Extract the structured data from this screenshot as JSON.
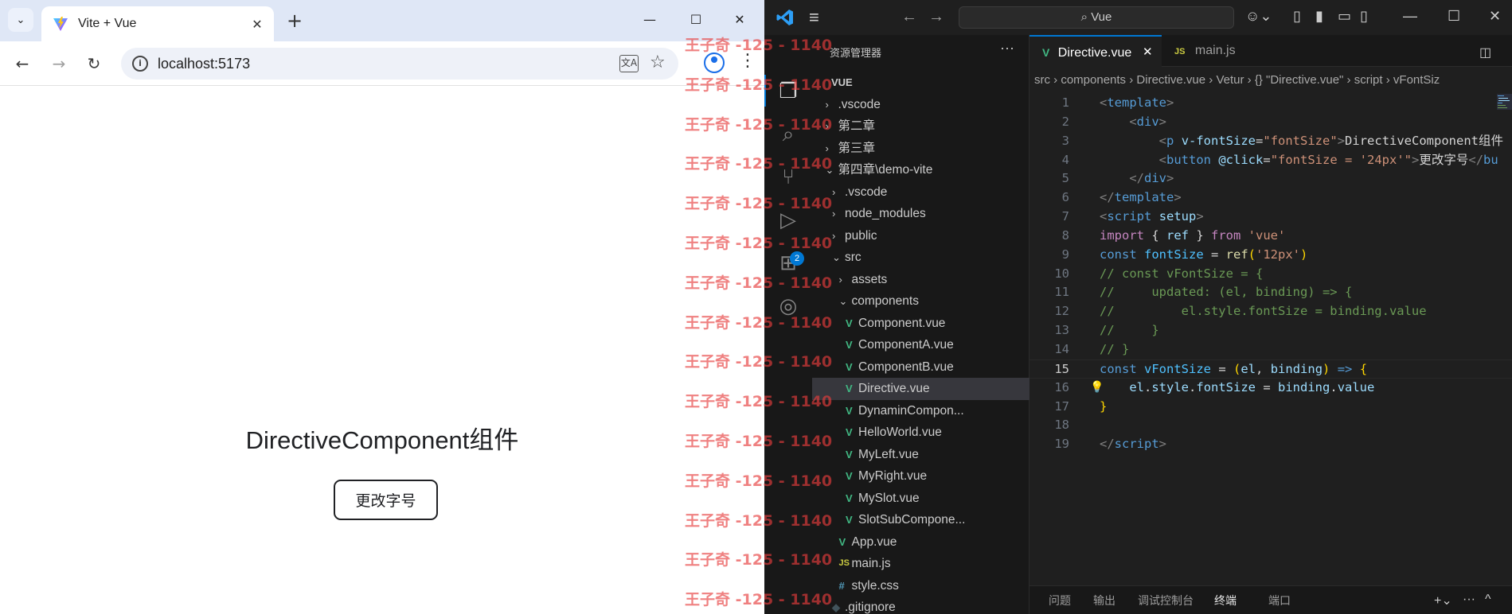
{
  "browser": {
    "tab": {
      "title": "Vite + Vue",
      "close": "✕"
    },
    "new_tab": "+",
    "window": {
      "min": "—",
      "max": "☐",
      "close": "✕"
    },
    "nav": {
      "back": "←",
      "forward": "→",
      "reload": "↻"
    },
    "address": {
      "url": "localhost:5173"
    },
    "page": {
      "heading": "DirectiveComponent组件",
      "button": "更改字号"
    }
  },
  "vscode": {
    "titlebar": {
      "search": "⌕ Vue"
    },
    "activity_badge": "2",
    "sidebar": {
      "title": "资源管理器",
      "more": "···",
      "tree": [
        {
          "label": "VUE",
          "chevron": "",
          "icon": "",
          "indent": 0,
          "bold": true
        },
        {
          "label": ".vscode",
          "chevron": "›",
          "icon": "",
          "indent": 1
        },
        {
          "label": "第二章",
          "chevron": "›",
          "icon": "",
          "indent": 1
        },
        {
          "label": "第三章",
          "chevron": "›",
          "icon": "",
          "indent": 1
        },
        {
          "label": "第四章\\demo-vite",
          "chevron": "⌄",
          "icon": "",
          "indent": 1
        },
        {
          "label": ".vscode",
          "chevron": "›",
          "icon": "",
          "indent": 2
        },
        {
          "label": "node_modules",
          "chevron": "›",
          "icon": "",
          "indent": 2
        },
        {
          "label": "public",
          "chevron": "›",
          "icon": "",
          "indent": 2
        },
        {
          "label": "src",
          "chevron": "⌄",
          "icon": "",
          "indent": 2
        },
        {
          "label": "assets",
          "chevron": "›",
          "icon": "",
          "indent": 3
        },
        {
          "label": "components",
          "chevron": "⌄",
          "icon": "",
          "indent": 3
        },
        {
          "label": "Component.vue",
          "chevron": "",
          "icon": "vue",
          "indent": 4
        },
        {
          "label": "ComponentA.vue",
          "chevron": "",
          "icon": "vue",
          "indent": 4
        },
        {
          "label": "ComponentB.vue",
          "chevron": "",
          "icon": "vue",
          "indent": 4
        },
        {
          "label": "Directive.vue",
          "chevron": "",
          "icon": "vue",
          "indent": 4,
          "selected": true
        },
        {
          "label": "DynaminCompon...",
          "chevron": "",
          "icon": "vue",
          "indent": 4
        },
        {
          "label": "HelloWorld.vue",
          "chevron": "",
          "icon": "vue",
          "indent": 4
        },
        {
          "label": "MyLeft.vue",
          "chevron": "",
          "icon": "vue",
          "indent": 4
        },
        {
          "label": "MyRight.vue",
          "chevron": "",
          "icon": "vue",
          "indent": 4
        },
        {
          "label": "MySlot.vue",
          "chevron": "",
          "icon": "vue",
          "indent": 4
        },
        {
          "label": "SlotSubCompone...",
          "chevron": "",
          "icon": "vue",
          "indent": 4
        },
        {
          "label": "App.vue",
          "chevron": "",
          "icon": "vue",
          "indent": 3
        },
        {
          "label": "main.js",
          "chevron": "",
          "icon": "js",
          "indent": 3
        },
        {
          "label": "style.css",
          "chevron": "",
          "icon": "css",
          "indent": 3
        },
        {
          "label": ".gitignore",
          "chevron": "",
          "icon": "git",
          "indent": 2
        }
      ]
    },
    "tabs": [
      {
        "label": "Directive.vue",
        "icon": "vue",
        "active": true,
        "close": "✕"
      },
      {
        "label": "main.js",
        "icon": "js",
        "active": false
      }
    ],
    "breadcrumb": {
      "parts": [
        "src",
        "components",
        "Directive.vue",
        "Vetur",
        "{} \"Directive.vue\"",
        "script",
        "vFontSiz"
      ]
    },
    "editor": {
      "active_line": 15,
      "lines": [
        [
          [
            "<",
            "#808080"
          ],
          [
            "template",
            "#569cd6"
          ],
          [
            ">",
            "#808080"
          ]
        ],
        [
          [
            "    ",
            "#d4d4d4"
          ],
          [
            "<",
            "#808080"
          ],
          [
            "div",
            "#569cd6"
          ],
          [
            ">",
            "#808080"
          ]
        ],
        [
          [
            "        ",
            "#d4d4d4"
          ],
          [
            "<",
            "#808080"
          ],
          [
            "p",
            "#569cd6"
          ],
          [
            " ",
            "#d4d4d4"
          ],
          [
            "v-fontSize",
            "#9cdcfe"
          ],
          [
            "=",
            "#d4d4d4"
          ],
          [
            "\"fontSize\"",
            "#ce9178"
          ],
          [
            ">",
            "#808080"
          ],
          [
            "DirectiveComponent组件",
            "#d4d4d4"
          ]
        ],
        [
          [
            "        ",
            "#d4d4d4"
          ],
          [
            "<",
            "#808080"
          ],
          [
            "button",
            "#569cd6"
          ],
          [
            " ",
            "#d4d4d4"
          ],
          [
            "@click",
            "#9cdcfe"
          ],
          [
            "=",
            "#d4d4d4"
          ],
          [
            "\"fontSize = ",
            "#ce9178"
          ],
          [
            "'24px'",
            "#ce9178"
          ],
          [
            "\"",
            "#ce9178"
          ],
          [
            ">",
            "#808080"
          ],
          [
            "更改字号",
            "#d4d4d4"
          ],
          [
            "</",
            "#808080"
          ],
          [
            "bu",
            "#569cd6"
          ]
        ],
        [
          [
            "    ",
            "#d4d4d4"
          ],
          [
            "</",
            "#808080"
          ],
          [
            "div",
            "#569cd6"
          ],
          [
            ">",
            "#808080"
          ]
        ],
        [
          [
            "</",
            "#808080"
          ],
          [
            "template",
            "#569cd6"
          ],
          [
            ">",
            "#808080"
          ]
        ],
        [
          [
            "<",
            "#808080"
          ],
          [
            "script",
            "#569cd6"
          ],
          [
            " ",
            "#d4d4d4"
          ],
          [
            "setup",
            "#9cdcfe"
          ],
          [
            ">",
            "#808080"
          ]
        ],
        [
          [
            "import",
            "#c586c0"
          ],
          [
            " { ",
            "#d4d4d4"
          ],
          [
            "ref",
            "#9cdcfe"
          ],
          [
            " } ",
            "#d4d4d4"
          ],
          [
            "from",
            "#c586c0"
          ],
          [
            " ",
            "#d4d4d4"
          ],
          [
            "'vue'",
            "#ce9178"
          ]
        ],
        [
          [
            "const",
            "#569cd6"
          ],
          [
            " ",
            "#d4d4d4"
          ],
          [
            "fontSize",
            "#4fc1ff"
          ],
          [
            " = ",
            "#d4d4d4"
          ],
          [
            "ref",
            "#dcdcaa"
          ],
          [
            "(",
            "#ffd700"
          ],
          [
            "'12px'",
            "#ce9178"
          ],
          [
            ")",
            "#ffd700"
          ]
        ],
        [
          [
            "// const vFontSize = {",
            "#6a9955"
          ]
        ],
        [
          [
            "//     updated: (el, binding) => {",
            "#6a9955"
          ]
        ],
        [
          [
            "//         el.style.fontSize = binding.value",
            "#6a9955"
          ]
        ],
        [
          [
            "//     }",
            "#6a9955"
          ]
        ],
        [
          [
            "// }",
            "#6a9955"
          ]
        ],
        [
          [
            "const",
            "#569cd6"
          ],
          [
            " ",
            "#d4d4d4"
          ],
          [
            "vFontSize",
            "#4fc1ff"
          ],
          [
            " = ",
            "#d4d4d4"
          ],
          [
            "(",
            "#ffd700"
          ],
          [
            "el",
            "#9cdcfe"
          ],
          [
            ", ",
            "#d4d4d4"
          ],
          [
            "binding",
            "#9cdcfe"
          ],
          [
            ")",
            "#ffd700"
          ],
          [
            " ",
            "#d4d4d4"
          ],
          [
            "=>",
            "#569cd6"
          ],
          [
            " ",
            "#d4d4d4"
          ],
          [
            "{",
            "#ffd700"
          ]
        ],
        [
          [
            "    ",
            "#d4d4d4"
          ],
          [
            "el",
            "#9cdcfe"
          ],
          [
            ".",
            "#d4d4d4"
          ],
          [
            "style",
            "#9cdcfe"
          ],
          [
            ".",
            "#d4d4d4"
          ],
          [
            "fontSize",
            "#9cdcfe"
          ],
          [
            " = ",
            "#d4d4d4"
          ],
          [
            "binding",
            "#9cdcfe"
          ],
          [
            ".",
            "#d4d4d4"
          ],
          [
            "value",
            "#9cdcfe"
          ]
        ],
        [
          [
            "}",
            "#ffd700"
          ]
        ],
        [],
        [
          [
            "</",
            "#808080"
          ],
          [
            "script",
            "#569cd6"
          ],
          [
            ">",
            "#808080"
          ]
        ]
      ]
    },
    "panel": {
      "tabs": [
        "问题",
        "输出",
        "调试控制台",
        "终端",
        "端口"
      ],
      "active": "终端",
      "actions": [
        "+⌄",
        "···",
        "^",
        "✕"
      ]
    }
  },
  "watermark": {
    "text": "王子奇 -125 - 1140",
    "repeat": 15
  }
}
